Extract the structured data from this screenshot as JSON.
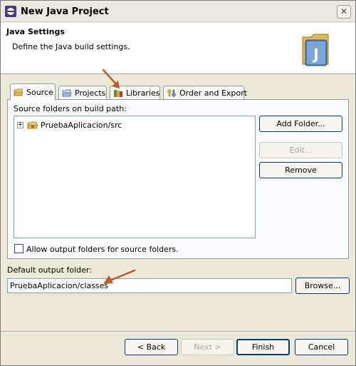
{
  "window": {
    "title": "New Java Project",
    "close_glyph": "✕",
    "icon": "eclipse-app-icon"
  },
  "header": {
    "title": "Java Settings",
    "description": "Define the Java build settings.",
    "logo_icon": "java-project-icon",
    "logo_letter": "J"
  },
  "tabs": [
    {
      "label": "Source",
      "icon": "source-folder-icon",
      "active": true
    },
    {
      "label": "Projects",
      "icon": "projects-folder-icon",
      "active": false
    },
    {
      "label": "Libraries",
      "icon": "libraries-icon",
      "active": false
    },
    {
      "label": "Order and Export",
      "icon": "order-export-icon",
      "active": false
    }
  ],
  "source_tab": {
    "tree_label": "Source folders on build path:",
    "tree_items": [
      {
        "label": "PruebaAplicacion/src",
        "expander": "+",
        "icon": "package-folder-icon"
      }
    ],
    "add_folder_label": "Add Folder...",
    "edit_label": "Edit...",
    "remove_label": "Remove",
    "allow_output_label": "Allow output folders for source folders.",
    "allow_output_checked": false
  },
  "output": {
    "label": "Default output folder:",
    "value": "PruebaAplicacion/classes",
    "browse_label": "Browse..."
  },
  "footer": {
    "back_label": "< Back",
    "next_label": "Next >",
    "finish_label": "Finish",
    "cancel_label": "Cancel"
  },
  "colors": {
    "annotation_arrow": "#c0592b",
    "dialog_background": "#ece9d8",
    "button_border": "#003c74"
  }
}
